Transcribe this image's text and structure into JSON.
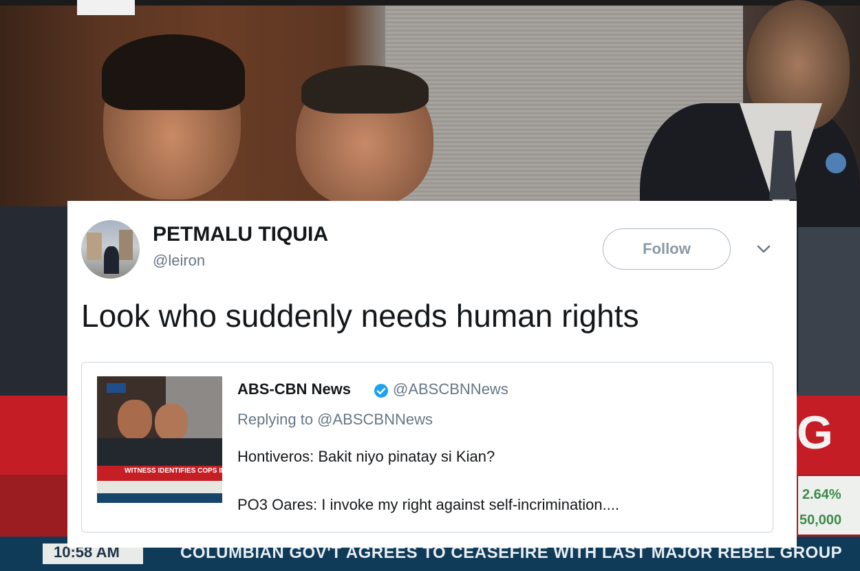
{
  "broadcast": {
    "time": "10:58 AM",
    "ticker": "COLUMBIAN GOV'T AGREES TO CEASEFIRE WITH LAST MAJOR REBEL GROUP",
    "side_letter": "G",
    "side_value_1": "2.64%",
    "side_value_2": "50,000"
  },
  "tweet": {
    "display_name": "PETMALU TIQUIA",
    "handle": "@leiron",
    "follow_label": "Follow",
    "text": "Look who suddenly needs human rights",
    "quoted": {
      "display_name": "ABS-CBN News",
      "handle": "@ABSCBNNews",
      "replying_to": "Replying to @ABSCBNNews",
      "line1": "Hontiveros: Bakit niyo pinatay si Kian?",
      "line2": "PO3 Oares: I invoke my right against self-incrimination....",
      "thumb_caption": "WITNESS IDENTIFIES COPS INVOLVED IN"
    }
  },
  "colors": {
    "verified": "#1da1f2",
    "text": "#14171a",
    "muted": "#657786",
    "border": "#ccd6dd"
  },
  "icons": {
    "verified": "verified-badge-icon",
    "chevron": "chevron-down-icon"
  }
}
